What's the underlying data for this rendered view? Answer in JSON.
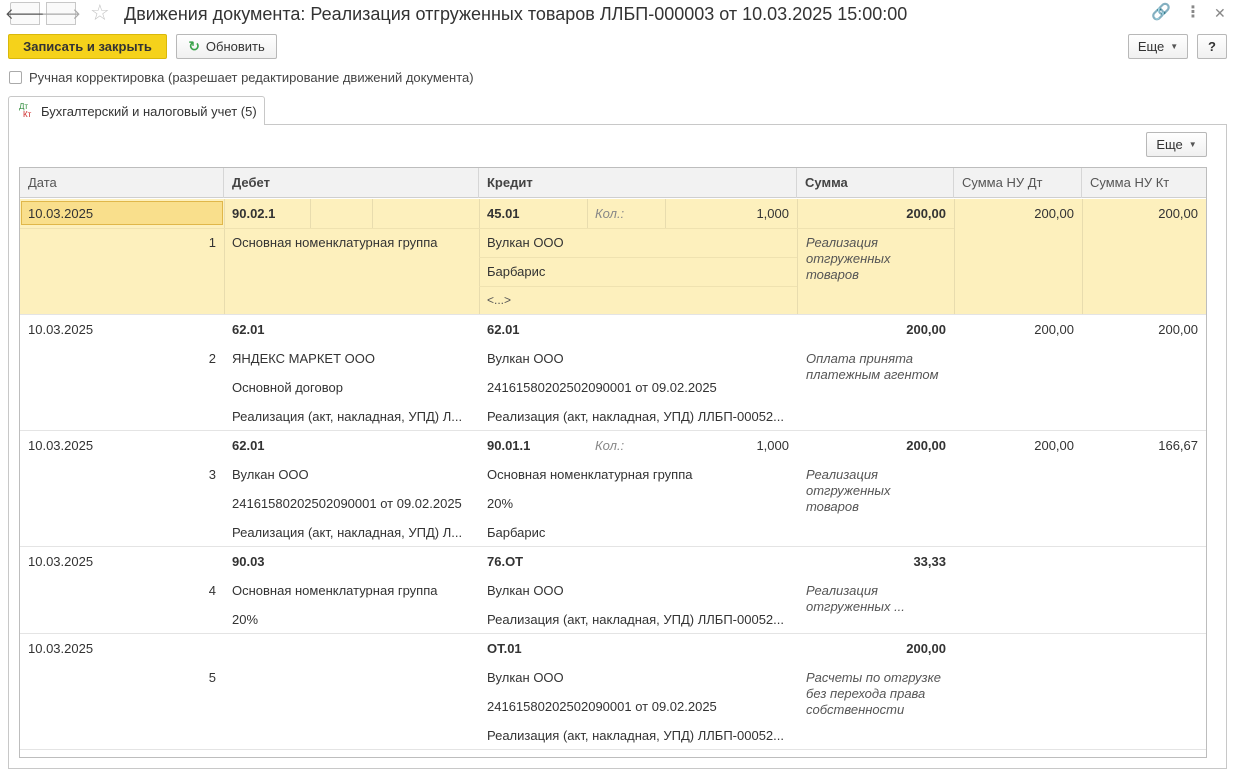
{
  "window": {
    "title": "Движения документа: Реализация отгруженных товаров ЛЛБП-000003 от 10.03.2025 15:00:00"
  },
  "toolbar": {
    "save_close": "Записать и закрыть",
    "refresh": "Обновить",
    "more": "Еще",
    "help": "?"
  },
  "manual_edit": {
    "label": "Ручная корректировка (разрешает редактирование движений документа)",
    "checked": false
  },
  "tabs": [
    {
      "icon_top": "Дт",
      "icon_bottom": "Кт",
      "label": "Бухгалтерский и налоговый учет (5)"
    }
  ],
  "panel": {
    "more": "Еще"
  },
  "table": {
    "headers": [
      "Дата",
      "Дебет",
      "Кредит",
      "Сумма",
      "Сумма НУ Дт",
      "Сумма НУ Кт"
    ],
    "rows": [
      {
        "date": "10.03.2025",
        "n": "1",
        "debit": [
          "90.02.1",
          "Основная номенклатурная группа"
        ],
        "credit": [
          "45.01",
          "Вулкан ООО",
          "Барбарис",
          "<...>"
        ],
        "qty_label": "Кол.:",
        "qty": "1,000",
        "sum": "200,00",
        "comment": "Реализация отгруженных товаров",
        "nu_dt": "200,00",
        "nu_kt": "200,00"
      },
      {
        "date": "10.03.2025",
        "n": "2",
        "debit": [
          "62.01",
          "ЯНДЕКС МАРКЕТ ООО",
          "Основной договор",
          "Реализация (акт, накладная, УПД) Л..."
        ],
        "credit": [
          "62.01",
          "Вулкан ООО",
          "24161580202502090001 от 09.02.2025",
          "Реализация (акт, накладная, УПД) ЛЛБП-00052..."
        ],
        "sum": "200,00",
        "comment": "Оплата принята платежным агентом",
        "nu_dt": "200,00",
        "nu_kt": "200,00"
      },
      {
        "date": "10.03.2025",
        "n": "3",
        "debit": [
          "62.01",
          "Вулкан ООО",
          "24161580202502090001 от 09.02.2025",
          "Реализация (акт, накладная, УПД) Л..."
        ],
        "credit": [
          "90.01.1",
          "Основная номенклатурная группа",
          "20%",
          "Барбарис"
        ],
        "qty_label": "Кол.:",
        "qty": "1,000",
        "sum": "200,00",
        "comment": "Реализация отгруженных товаров",
        "nu_dt": "200,00",
        "nu_kt": "166,67"
      },
      {
        "date": "10.03.2025",
        "n": "4",
        "debit": [
          "90.03",
          "Основная номенклатурная группа",
          "20%"
        ],
        "credit": [
          "76.ОТ",
          "Вулкан ООО",
          "Реализация (акт, накладная, УПД) ЛЛБП-00052..."
        ],
        "sum": "33,33",
        "comment": "Реализация отгруженных ...",
        "nu_dt": "",
        "nu_kt": ""
      },
      {
        "date": "10.03.2025",
        "n": "5",
        "debit": [],
        "credit": [
          "ОТ.01",
          "Вулкан ООО",
          "24161580202502090001 от 09.02.2025",
          "Реализация (акт, накладная, УПД) ЛЛБП-00052..."
        ],
        "sum": "200,00",
        "comment": "Расчеты по отгрузке без перехода права собственности",
        "nu_dt": "",
        "nu_kt": ""
      }
    ]
  }
}
